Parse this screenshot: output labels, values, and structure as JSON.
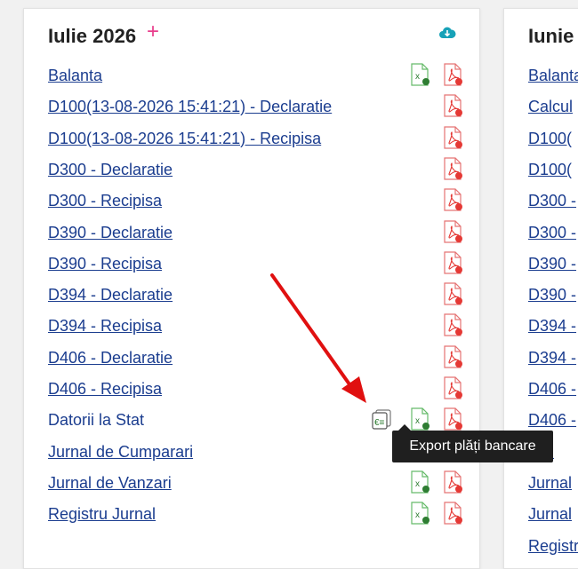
{
  "left_card": {
    "title": "Iulie 2026",
    "add_label": "+",
    "rows": [
      {
        "label": "Balanta",
        "link": true,
        "icons": [
          "excel",
          "pdf"
        ]
      },
      {
        "label": "D100(13-08-2026 15:41:21) - Declaratie",
        "link": true,
        "icons": [
          "pdf"
        ]
      },
      {
        "label": "D100(13-08-2026 15:41:21) - Recipisa",
        "link": true,
        "icons": [
          "pdf"
        ]
      },
      {
        "label": "D300 - Declaratie",
        "link": true,
        "icons": [
          "pdf"
        ]
      },
      {
        "label": "D300 - Recipisa",
        "link": true,
        "icons": [
          "pdf"
        ]
      },
      {
        "label": "D390 - Declaratie",
        "link": true,
        "icons": [
          "pdf"
        ]
      },
      {
        "label": "D390 - Recipisa",
        "link": true,
        "icons": [
          "pdf"
        ]
      },
      {
        "label": "D394 - Declaratie",
        "link": true,
        "icons": [
          "pdf"
        ]
      },
      {
        "label": "D394 - Recipisa",
        "link": true,
        "icons": [
          "pdf"
        ]
      },
      {
        "label": "D406 - Declaratie",
        "link": true,
        "icons": [
          "pdf"
        ]
      },
      {
        "label": "D406 - Recipisa",
        "link": true,
        "icons": [
          "pdf"
        ]
      },
      {
        "label": "Datorii la Stat",
        "link": false,
        "icons": [
          "bank",
          "excel",
          "pdf"
        ]
      },
      {
        "label": "Jurnal de Cumparari",
        "link": true,
        "icons": []
      },
      {
        "label": "Jurnal de Vanzari",
        "link": true,
        "icons": [
          "excel",
          "pdf"
        ]
      },
      {
        "label": "Registru Jurnal",
        "link": true,
        "icons": [
          "excel",
          "pdf"
        ]
      }
    ]
  },
  "right_card": {
    "title": "Iunie",
    "rows": [
      "Balanta",
      "Calcul",
      "D100(",
      "D100(",
      "D300 -",
      "D300 -",
      "D390 -",
      "D390 -",
      "D394 -",
      "D394 -",
      "D406 -",
      "D406 -",
      "torii",
      "Jurnal",
      "Jurnal",
      "Registr"
    ]
  },
  "tooltip": {
    "text": "Export plăți bancare"
  },
  "colors": {
    "link": "#1b3d8f",
    "pdf": "#e53935",
    "excel": "#2e7d32",
    "add": "#e83e8c",
    "cloud": "#17a2b8",
    "arrow": "#e01010"
  }
}
